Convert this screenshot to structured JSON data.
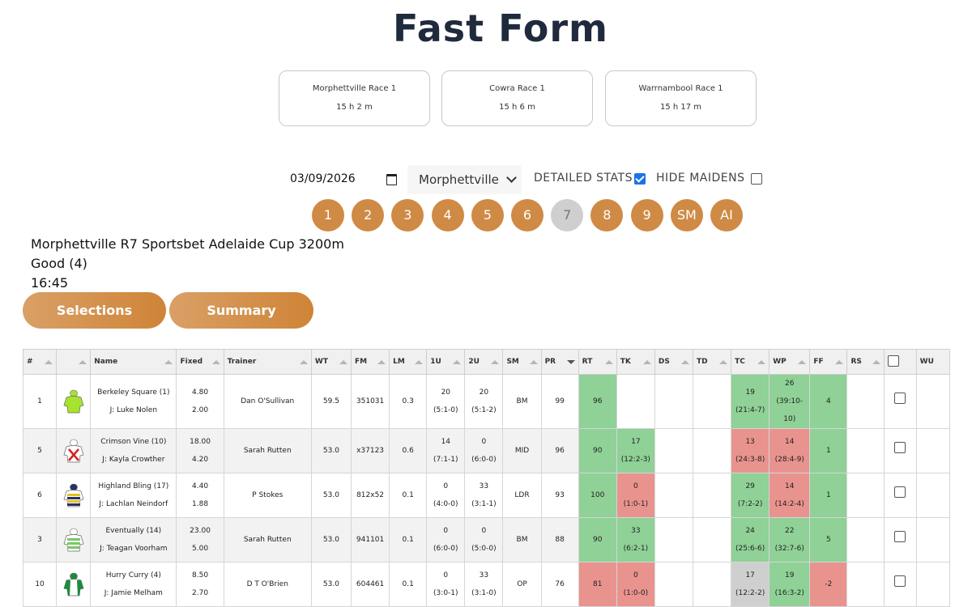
{
  "title": "Fast Form",
  "next_races": [
    {
      "name": "Morphettville Race 1",
      "time": "15 h 2 m"
    },
    {
      "name": "Cowra Race 1",
      "time": "15 h 6 m"
    },
    {
      "name": "Warrnambool Race 1",
      "time": "15 h 17 m"
    }
  ],
  "controls": {
    "date": "03/09/2026",
    "venue": "Morphettville",
    "detailed_stats_label": "DETAILED STATS",
    "detailed_stats_checked": true,
    "hide_maidens_label": "HIDE MAIDENS",
    "hide_maidens_checked": false
  },
  "race_buttons": [
    "1",
    "2",
    "3",
    "4",
    "5",
    "6",
    "7",
    "8",
    "9",
    "SM",
    "AI"
  ],
  "selected_race": "7",
  "race_info": {
    "line1": "Morphettville R7 Sportsbet Adelaide Cup 3200m",
    "line2": "Good (4)",
    "line3": "16:45"
  },
  "tabs": {
    "selections": "Selections",
    "summary": "Summary"
  },
  "table": {
    "headers": [
      "#",
      "",
      "Name",
      "Fixed",
      "Trainer",
      "WT",
      "FM",
      "LM",
      "1U",
      "2U",
      "SM",
      "PR",
      "RT",
      "TK",
      "DS",
      "TD",
      "TC",
      "WP",
      "FF",
      "RS",
      "",
      "WU"
    ],
    "rows": [
      {
        "num": "1",
        "silk": "lime",
        "name": "Berkeley Square (1)",
        "jockey": "J: Luke Nolen",
        "fixed1": "4.80",
        "fixed2": "2.00",
        "trainer": "Dan O'Sullivan",
        "wt": "59.5",
        "fm": "351031",
        "lm": "0.3",
        "u1a": "20",
        "u1b": "(5:1-0)",
        "u2a": "20",
        "u2b": "(5:1-2)",
        "sm": "BM",
        "pr": "99",
        "rt": "96",
        "rt_c": "g",
        "tka": "",
        "tkb": "",
        "tk_c": "w",
        "tca": "19",
        "tcb": "(21:4-7)",
        "tc_c": "g",
        "wpa": "26",
        "wpb": "(39:10-10)",
        "wp_c": "g",
        "ff": "4",
        "ff_c": "g"
      },
      {
        "num": "5",
        "silk": "cross",
        "name": "Crimson Vine (10)",
        "jockey": "J: Kayla Crowther",
        "fixed1": "18.00",
        "fixed2": "4.20",
        "trainer": "Sarah Rutten",
        "wt": "53.0",
        "fm": "x37123",
        "lm": "0.6",
        "u1a": "14",
        "u1b": "(7:1-1)",
        "u2a": "0",
        "u2b": "(6:0-0)",
        "sm": "MID",
        "pr": "96",
        "rt": "90",
        "rt_c": "g",
        "tka": "17",
        "tkb": "(12:2-3)",
        "tk_c": "g",
        "tca": "13",
        "tcb": "(24:3-8)",
        "tc_c": "r",
        "wpa": "14",
        "wpb": "(28:4-9)",
        "wp_c": "r",
        "ff": "1",
        "ff_c": "g"
      },
      {
        "num": "6",
        "silk": "stripe",
        "name": "Highland Bling (17)",
        "jockey": "J: Lachlan Neindorf",
        "fixed1": "4.40",
        "fixed2": "1.88",
        "trainer": "P Stokes",
        "wt": "53.0",
        "fm": "812x52",
        "lm": "0.1",
        "u1a": "0",
        "u1b": "(4:0-0)",
        "u2a": "33",
        "u2b": "(3:1-1)",
        "sm": "LDR",
        "pr": "93",
        "rt": "100",
        "rt_c": "g",
        "tka": "0",
        "tkb": "(1:0-1)",
        "tk_c": "r",
        "tca": "29",
        "tcb": "(7:2-2)",
        "tc_c": "g",
        "wpa": "14",
        "wpb": "(14:2-4)",
        "wp_c": "r",
        "ff": "1",
        "ff_c": "g"
      },
      {
        "num": "3",
        "silk": "green",
        "name": "Eventually (14)",
        "jockey": "J: Teagan Voorham",
        "fixed1": "23.00",
        "fixed2": "5.00",
        "trainer": "Sarah Rutten",
        "wt": "53.0",
        "fm": "941101",
        "lm": "0.1",
        "u1a": "0",
        "u1b": "(6:0-0)",
        "u2a": "0",
        "u2b": "(5:0-0)",
        "sm": "BM",
        "pr": "88",
        "rt": "90",
        "rt_c": "g",
        "tka": "33",
        "tkb": "(6:2-1)",
        "tk_c": "g",
        "tca": "24",
        "tcb": "(25:6-6)",
        "tc_c": "g",
        "wpa": "22",
        "wpb": "(32:7-6)",
        "wp_c": "g",
        "ff": "5",
        "ff_c": "g"
      },
      {
        "num": "10",
        "silk": "greenwhite",
        "name": "Hurry Curry (4)",
        "jockey": "J: Jamie Melham",
        "fixed1": "8.50",
        "fixed2": "2.70",
        "trainer": "D T O'Brien",
        "wt": "53.0",
        "fm": "604461",
        "lm": "0.1",
        "u1a": "0",
        "u1b": "(3:0-1)",
        "u2a": "33",
        "u2b": "(3:1-0)",
        "sm": "OP",
        "pr": "76",
        "rt": "81",
        "rt_c": "r",
        "tka": "0",
        "tkb": "(1:0-0)",
        "tk_c": "r",
        "tca": "17",
        "tcb": "(12:2-2)",
        "tc_c": "gr",
        "wpa": "19",
        "wpb": "(16:3-2)",
        "wp_c": "g",
        "ff": "-2",
        "ff_c": "r"
      }
    ]
  }
}
